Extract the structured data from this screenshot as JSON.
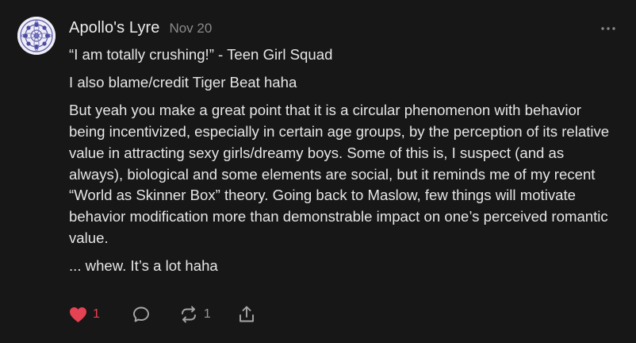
{
  "comment": {
    "author": "Apollo's Lyre",
    "date": "Nov 20",
    "paragraphs": [
      "“I am totally crushing!” - Teen Girl Squad",
      "I also blame/credit Tiger Beat haha",
      "But yeah you make a great point that it is a circular phenomenon with behavior being incentivized, especially in certain age groups, by the perception of its relative value in attracting sexy girls/dreamy boys. Some of this is, I suspect (and as always), biological and some elements are social, but it reminds me of my recent “World as Skinner Box” theory. Going back to Maslow, few things will motivate behavior modification more than demonstrable impact on one’s perceived romantic value.",
      "... whew. It’s a lot haha"
    ],
    "actions": {
      "like_count": "1",
      "restack_count": "1"
    }
  },
  "icons": {
    "avatar": "ornamental-pattern-avatar",
    "more": "ellipsis-icon",
    "like": "heart-icon",
    "reply": "speech-bubble-icon",
    "restack": "restack-arrows-icon",
    "share": "share-icon"
  },
  "colors": {
    "background": "#171717",
    "text": "#e6e6e6",
    "muted": "#8b8b8b",
    "like": "#e54253"
  }
}
